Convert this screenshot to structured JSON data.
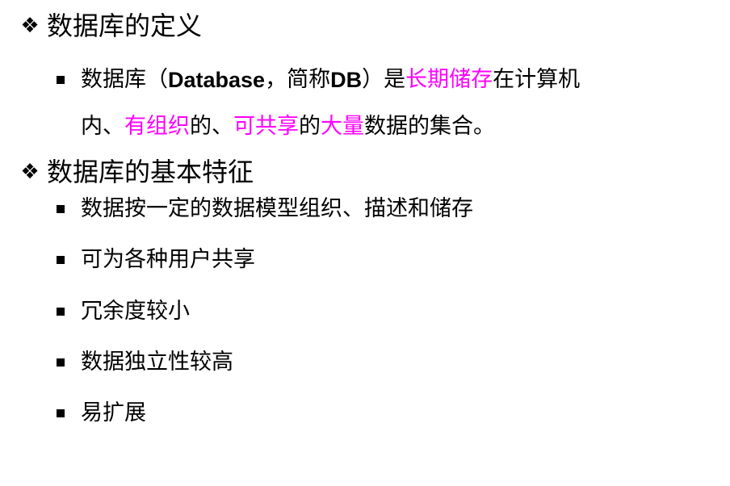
{
  "colors": {
    "text": "#000000",
    "highlight": "#ff00ff",
    "background": "#ffffff"
  },
  "icons": {
    "heading_marker": "diamond-four-petal-icon",
    "bullet_marker": "square-bullet-icon"
  },
  "section1": {
    "marker": "❖",
    "heading": "数据库的定义",
    "definition": {
      "p1": "数据库（",
      "latin_term": "Database",
      "p2": "，简称",
      "latin_abbr": "DB",
      "p3": "）是",
      "hl1": "长期储存",
      "p4": "在计算机",
      "p5": "内、",
      "hl2": "有组织",
      "p6": "的、",
      "hl3": "可共享",
      "p7": "的",
      "hl4": "大量",
      "p8": "数据的集合。"
    }
  },
  "section2": {
    "marker": "❖",
    "heading": "数据库的基本特征",
    "items": [
      "数据按一定的数据模型组织、描述和储存",
      "可为各种用户共享",
      "冗余度较小",
      "数据独立性较高",
      "易扩展"
    ]
  }
}
